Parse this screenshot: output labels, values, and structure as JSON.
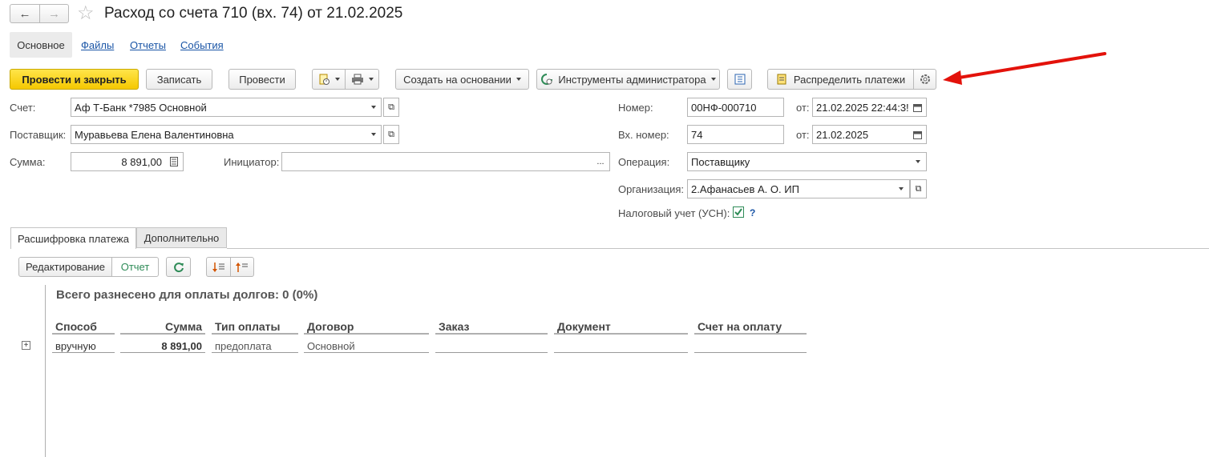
{
  "window": {
    "title": "Расход со счета 710 (вх. 74) от 21.02.2025",
    "nav_back": "←",
    "nav_forward": "→",
    "favorite": "☆"
  },
  "tabs_top": {
    "active": "Основное",
    "links": [
      "Файлы",
      "Отчеты",
      "События"
    ]
  },
  "toolbar": {
    "post_close": "Провести и закрыть",
    "save": "Записать",
    "post": "Провести",
    "create_based": "Создать на основании",
    "admin_tools": "Инструменты администратора",
    "distribute": "Распределить платежи"
  },
  "form": {
    "account_label": "Счет:",
    "account_value": "Аф Т-Банк *7985 Основной",
    "supplier_label": "Поставщик:",
    "supplier_value": "Муравьева Елена Валентиновна",
    "sum_label": "Сумма:",
    "sum_value": "8 891,00",
    "initiator_label": "Инициатор:",
    "initiator_value": "",
    "initiator_more": "...",
    "number_label": "Номер:",
    "number_value": "00НФ-000710",
    "date_label": "от:",
    "date_value": "21.02.2025 22:44:3!",
    "in_number_label": "Вх. номер:",
    "in_number_value": "74",
    "in_date_label": "от:",
    "in_date_value": "21.02.2025",
    "operation_label": "Операция:",
    "operation_value": "Поставщику",
    "org_label": "Организация:",
    "org_value": "2.Афанасьев А. О. ИП",
    "tax_label": "Налоговый учет (УСН):",
    "tax_checked": true,
    "tax_help": "?"
  },
  "subtabs": {
    "tab1": "Расшифровка платежа",
    "tab2": "Дополнительно",
    "mode_edit": "Редактирование",
    "mode_report": "Отчет"
  },
  "report": {
    "summary": "Всего разнесено для оплаты долгов: 0  (0%)",
    "columns": [
      "Способ",
      "Сумма",
      "Тип оплаты",
      "Договор",
      "Заказ",
      "Документ",
      "Счет на оплату"
    ],
    "row": {
      "method": "вручную",
      "sum": "8 891,00",
      "pay_type": "предоплата",
      "contract": "Основной",
      "order": "",
      "document": "",
      "invoice": ""
    },
    "expand": "+"
  },
  "colors": {
    "accent_yellow": "#f5c800",
    "link_blue": "#1a55a6",
    "arrow_red": "#e3120b",
    "check_green": "#2e8b57"
  }
}
